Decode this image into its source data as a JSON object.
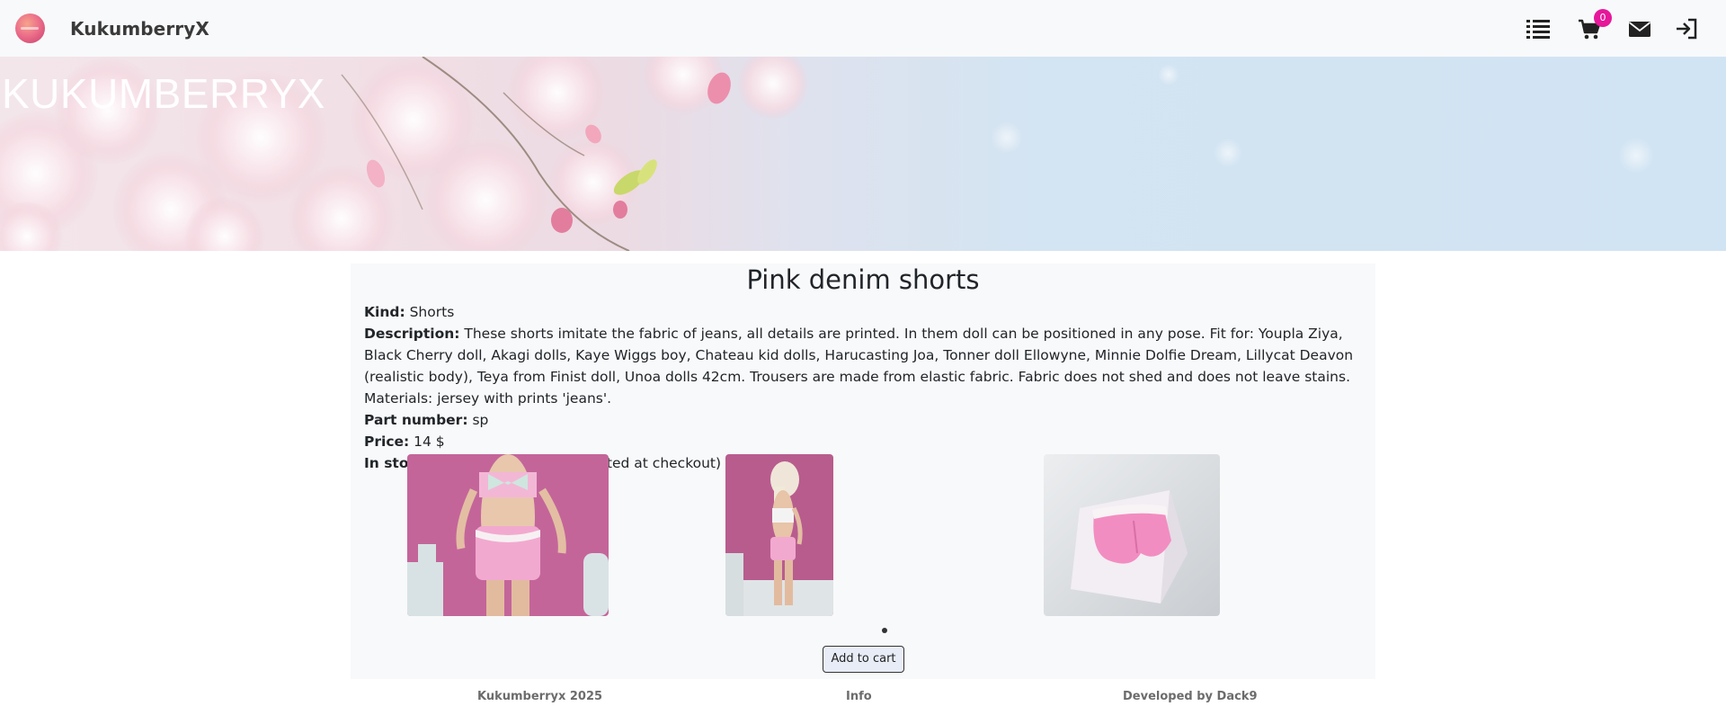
{
  "navbar": {
    "brand": "KukumberryX",
    "cart_count": "0",
    "icons": [
      "logo-icon",
      "list-icon",
      "cart-icon",
      "mail-icon",
      "login-icon"
    ]
  },
  "hero": {
    "title": "KUKUMBERRYX"
  },
  "product": {
    "title": "Pink denim shorts",
    "kind_label": "Kind:",
    "kind": "Shorts",
    "description_label": "Description:",
    "description": "These shorts imitate the fabric of jeans, all details are printed. In them doll can be positioned in any pose. Fit for: Youpla Ziya, Black Cherry doll, Akagi dolls, Kaye Wiggs boy, Chateau kid dolls, Harucasting Joa, Tonner doll Ellowyne, Minnie Dolfie Dream, Lillycat Deavon (realistic body), Teya from Finist doll, Unoa dolls 42cm. Trousers are made from elastic fabric. Fabric does not shed and does not leave stains. Materials: jersey with prints 'jeans'.",
    "part_number_label": "Part number:",
    "part_number": "sp",
    "price_label": "Price:",
    "price": "14 $",
    "in_stock_label": "In stock:",
    "in_stock": "2 (Quantity can be selected at checkout)",
    "add_to_cart": "Add to cart"
  },
  "footer": {
    "copyright": "Kukumberryx 2025",
    "info": "Info",
    "developer": "Developed by Dack9"
  },
  "colors": {
    "badge": "#e6179a",
    "navbar_bg": "#f8f9fa",
    "card_bg": "#f8f9fa",
    "button_bg": "#e7ecf7"
  }
}
